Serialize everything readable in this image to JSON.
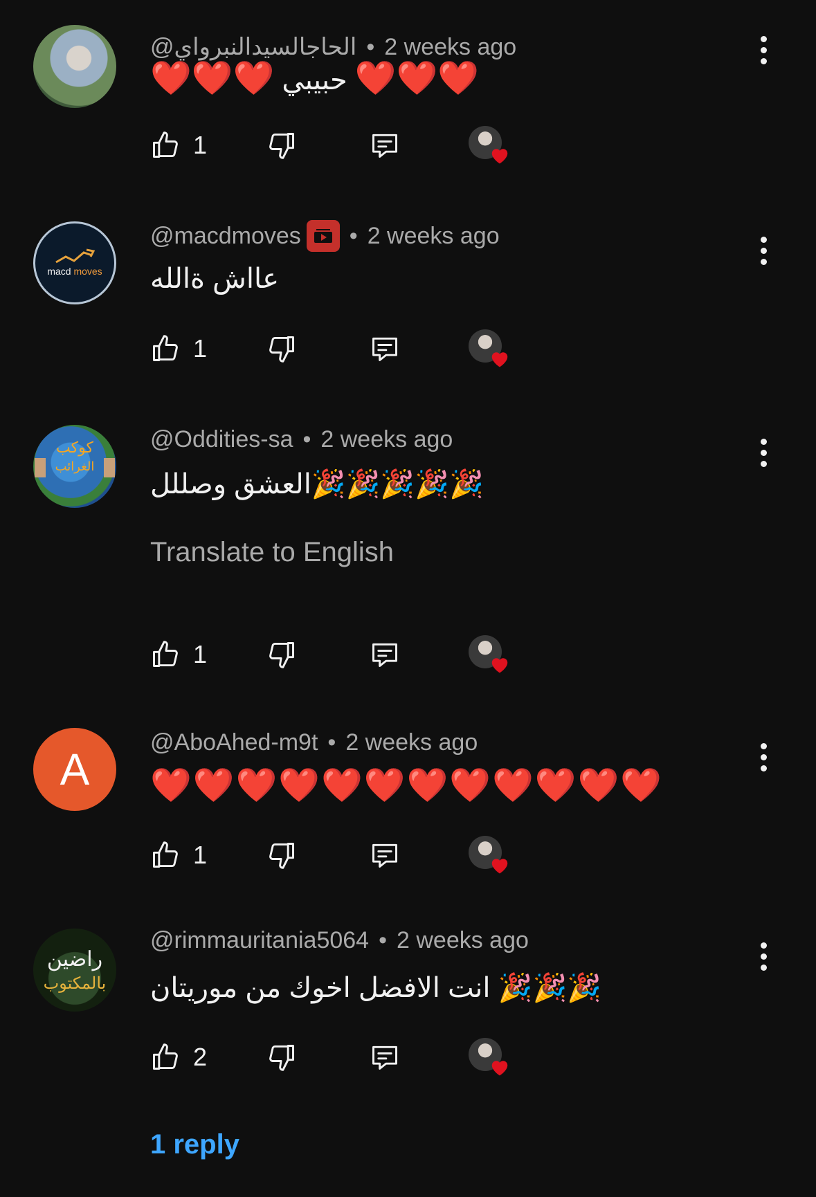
{
  "comments": [
    {
      "handle": "@الحاجالسيدالنبرواي",
      "time": "2 weeks ago",
      "text_parts": [
        "❤️❤️❤️",
        " حبيبي ",
        "❤️❤️❤️"
      ],
      "likes": "1",
      "avatar": {
        "type": "photo",
        "colors": [
          "#8aa0b0",
          "#d6c9b0"
        ]
      }
    },
    {
      "handle": "@macdmoves",
      "time": "2 weeks ago",
      "text": "عااش ةالله",
      "likes": "1",
      "avatar": {
        "type": "logo",
        "label": "macd moves"
      },
      "badge": "youtube-member-icon"
    },
    {
      "handle": "@Oddities-sa",
      "time": "2 weeks ago",
      "text": "العشق وصللل🎉🎉🎉🎉🎉",
      "translate": "Translate to English",
      "likes": "1",
      "avatar": {
        "type": "globe",
        "label": "كوكب الغرائب"
      }
    },
    {
      "handle": "@AboAhed-m9t",
      "time": "2 weeks ago",
      "text": "❤️❤️❤️❤️❤️❤️❤️❤️❤️❤️❤️❤️",
      "likes": "1",
      "avatar": {
        "type": "letter",
        "letter": "A",
        "color": "#e5582b"
      }
    },
    {
      "handle": "@rimmauritania5064",
      "time": "2 weeks ago",
      "text": "انت الافضل اخوك من موريتان 🎉🎉🎉",
      "likes": "2",
      "avatar": {
        "type": "text",
        "line1": "راضين",
        "line2": "بالمكتوب"
      }
    }
  ],
  "reply_link": "1 reply",
  "icons": {
    "like": "thumbs-up-icon",
    "dislike": "thumbs-down-icon",
    "reply": "reply-comment-icon",
    "creator_heart": "creator-heart-icon",
    "menu": "more-vertical-icon"
  },
  "colors": {
    "background": "#0f0f0f",
    "primary_text": "#f1f1f1",
    "secondary_text": "#aaaaaa",
    "link": "#3ea6ff",
    "heart": "#e0121f"
  }
}
